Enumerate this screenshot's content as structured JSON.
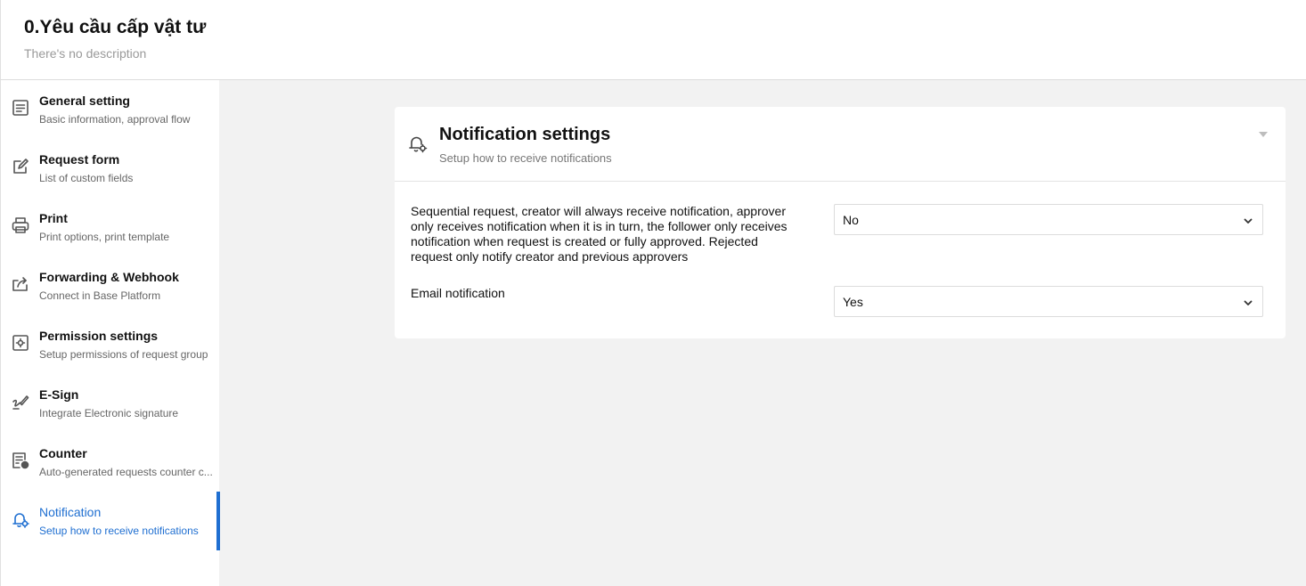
{
  "header": {
    "title": "0.Yêu cầu cấp vật tư",
    "description": "There's no description"
  },
  "sidebar": {
    "items": [
      {
        "label": "General setting",
        "sub": "Basic information, approval flow",
        "icon": "document-list-icon"
      },
      {
        "label": "Request form",
        "sub": "List of custom fields",
        "icon": "edit-form-icon"
      },
      {
        "label": "Print",
        "sub": "Print options, print template",
        "icon": "printer-icon"
      },
      {
        "label": "Forwarding & Webhook",
        "sub": "Connect in Base Platform",
        "icon": "share-forward-icon"
      },
      {
        "label": "Permission settings",
        "sub": "Setup permissions of request group",
        "icon": "permission-gear-icon"
      },
      {
        "label": "E-Sign",
        "sub": "Integrate Electronic signature",
        "icon": "signature-pen-icon"
      },
      {
        "label": "Counter",
        "sub": "Auto-generated requests counter c...",
        "icon": "counter-list-icon"
      },
      {
        "label": "Notification",
        "sub": "Setup how to receive notifications",
        "icon": "bell-gear-icon",
        "active": true
      }
    ]
  },
  "panel": {
    "title": "Notification settings",
    "subtitle": "Setup how to receive notifications",
    "settings": [
      {
        "label": "Sequential request, creator will always receive notification, approver only receives notification when it is in turn, the follower only receives notification when request is created or fully approved. Rejected request only notify creator and previous approvers",
        "value": "No"
      },
      {
        "label": "Email notification",
        "value": "Yes"
      }
    ]
  },
  "colors": {
    "accent": "#1f6fd1",
    "background": "#f2f2f2"
  }
}
